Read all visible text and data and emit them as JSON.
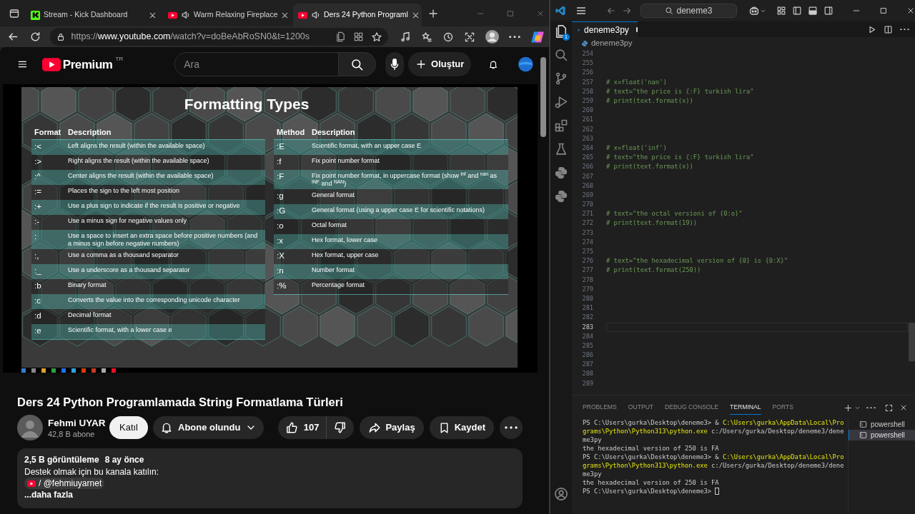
{
  "browser": {
    "tabs": [
      {
        "title": "Stream - Kick Dashboard",
        "kind": "kick",
        "audio": false,
        "selected": false
      },
      {
        "title": "Warm Relaxing Fireplace",
        "kind": "youtube",
        "audio": true,
        "selected": false
      },
      {
        "title": "Ders 24 Python Programl",
        "kind": "youtube",
        "audio": true,
        "selected": true
      }
    ],
    "url": {
      "scheme": "https://",
      "host": "www.youtube.com",
      "path": "/watch?v=doBeAbRoSN0&t=1200s"
    }
  },
  "youtube": {
    "logo": "Premium",
    "region": "TR",
    "search_placeholder": "Ara",
    "create": "Oluştur",
    "slide": {
      "title": "Formatting Types",
      "tables": [
        {
          "columns": [
            "Format",
            "Description"
          ],
          "rows": [
            {
              "code": ":<",
              "description": "Left aligns the result (within the available space)"
            },
            {
              "code": ":>",
              "description": "Right aligns the result (within the available space)"
            },
            {
              "code": ":^",
              "description": "Center aligns the result (within the available space)"
            },
            {
              "code": ":=",
              "description": "Places the sign to the left most position"
            },
            {
              "code": ":+",
              "description": "Use a plus sign to indicate if the result is positive or negative"
            },
            {
              "code": ":-",
              "description": "Use a minus sign for negative values only"
            },
            {
              "code": ":",
              "description": "Use a space to insert an extra space before positive numbers (and a minus sign before negative numbers)"
            },
            {
              "code": ":,",
              "description": "Use a comma as a thousand separator"
            },
            {
              "code": ":_",
              "description": "Use a underscore as a thousand separator"
            },
            {
              "code": ":b",
              "description": "Binary format"
            },
            {
              "code": ":c",
              "description": "Converts the value into the corresponding unicode character"
            },
            {
              "code": ":d",
              "description": "Decimal format"
            },
            {
              "code": ":e",
              "description": "Scientific format, with a lower case e"
            }
          ]
        },
        {
          "columns": [
            "Method",
            "Description"
          ],
          "rows": [
            {
              "code": ":E",
              "description": "Scientific format, with an upper case E"
            },
            {
              "code": ":f",
              "description": "Fix point number format"
            },
            {
              "code": ":F",
              "description": "Fix point number format, in uppercase format (show $^{inf}$ and $^{nan}$ as $^{INF}$ and $^{NAN}$)"
            },
            {
              "code": ":g",
              "description": "General format"
            },
            {
              "code": ":G",
              "description": "General format (using a upper case E for scientific notations)"
            },
            {
              "code": ":o",
              "description": "Octal format"
            },
            {
              "code": ":x",
              "description": "Hex format, lower case"
            },
            {
              "code": ":X",
              "description": "Hex format, upper case"
            },
            {
              "code": ":n",
              "description": "Number format"
            },
            {
              "code": ":%",
              "description": "Percentage format"
            }
          ]
        }
      ]
    },
    "video_title": "Ders 24 Python Programlamada String Formatlama Türleri",
    "channel": {
      "name": "Fehmi UYAR",
      "subscribers": "42,8 B abone"
    },
    "actions": {
      "join": "Katıl",
      "subscribe": "Abone olundu",
      "likes": "107",
      "share": "Paylaş",
      "save": "Kaydet"
    },
    "description": {
      "views": "2,5 B görüntüleme",
      "age": "8 ay önce",
      "text": "Destek olmak için bu kanala katılın:",
      "link": "/ @fehmiuyarnet",
      "more": "...daha fazla"
    }
  },
  "vscode": {
    "search": "deneme3",
    "explorer_badge": "1",
    "editor_tab": {
      "name": "deneme3py",
      "modified": true
    },
    "breadcrumb": "deneme3py",
    "lines": [
      {
        "number": "254",
        "current": false
      },
      {
        "number": "255",
        "current": false
      },
      {
        "number": "256",
        "current": false
      },
      {
        "number": "257",
        "text": "# x=float('nan')",
        "current": false
      },
      {
        "number": "258",
        "text": "# text=\"the price is {:F} turkish lira\"",
        "current": false
      },
      {
        "number": "259",
        "text": "# print(text.format(x))",
        "current": false
      },
      {
        "number": "260",
        "current": false
      },
      {
        "number": "261",
        "current": false
      },
      {
        "number": "262",
        "current": false
      },
      {
        "number": "263",
        "current": false
      },
      {
        "number": "264",
        "text": "# x=float('inf')",
        "current": false
      },
      {
        "number": "265",
        "text": "# text=\"the price is {:F} turkish lira\"",
        "current": false
      },
      {
        "number": "266",
        "text": "# print(text.format(x))",
        "current": false
      },
      {
        "number": "267",
        "current": false
      },
      {
        "number": "268",
        "current": false
      },
      {
        "number": "269",
        "current": false
      },
      {
        "number": "270",
        "current": false
      },
      {
        "number": "271",
        "text": "# text=\"the octal versioni of {0:o}\"",
        "current": false
      },
      {
        "number": "272",
        "text": "# print(text.format(19))",
        "current": false
      },
      {
        "number": "273",
        "current": false
      },
      {
        "number": "274",
        "current": false
      },
      {
        "number": "275",
        "current": false
      },
      {
        "number": "276",
        "text": "# text=\"the hexadecimal version of {0} is {0:X}\"",
        "current": false
      },
      {
        "number": "277",
        "text": "# print(text.format(250))",
        "current": false
      },
      {
        "number": "278",
        "current": false
      },
      {
        "number": "279",
        "current": false
      },
      {
        "number": "280",
        "current": false
      },
      {
        "number": "281",
        "current": false
      },
      {
        "number": "282",
        "current": false
      },
      {
        "number": "283",
        "current": true
      },
      {
        "number": "284",
        "current": false
      },
      {
        "number": "285",
        "current": false
      },
      {
        "number": "286",
        "current": false
      },
      {
        "number": "287",
        "current": false
      },
      {
        "number": "288",
        "current": false
      },
      {
        "number": "289",
        "current": false
      }
    ],
    "panel": {
      "tabs": [
        {
          "label": "PROBLEMS",
          "selected": false
        },
        {
          "label": "OUTPUT",
          "selected": false
        },
        {
          "label": "DEBUG CONSOLE",
          "selected": false
        },
        {
          "label": "TERMINAL",
          "selected": true
        },
        {
          "label": "PORTS",
          "selected": false
        }
      ],
      "terminal_lines": [
        [
          {
            "kind": "plain",
            "text": "PS C:\\Users\\gurka\\Desktop\\deneme3> & "
          },
          {
            "kind": "path",
            "text": "C:\\Users\\gurka\\AppData\\Local\\Pro"
          }
        ],
        [
          {
            "kind": "path",
            "text": "grams\\Python\\Python313\\python.exe"
          },
          {
            "kind": "plain",
            "text": " c:/Users/gurka/Desktop/deneme3/dene"
          }
        ],
        [
          {
            "kind": "plain",
            "text": "me3py"
          }
        ],
        [
          {
            "kind": "plain",
            "text": "the hexadecimal version of 250 is FA"
          }
        ],
        [
          {
            "kind": "plain",
            "text": "PS C:\\Users\\gurka\\Desktop\\deneme3> & "
          },
          {
            "kind": "path",
            "text": "C:\\Users\\gurka\\AppData\\Local\\Pro"
          }
        ],
        [
          {
            "kind": "path",
            "text": "grams\\Python\\Python313\\python.exe"
          },
          {
            "kind": "plain",
            "text": " c:/Users/gurka/Desktop/deneme3/dene"
          }
        ],
        [
          {
            "kind": "plain",
            "text": "me3py"
          }
        ],
        [
          {
            "kind": "plain",
            "text": "the hexadecimal version of 250 is FA"
          }
        ],
        [
          {
            "kind": "plain",
            "text": "PS C:\\Users\\gurka\\Desktop\\deneme3> "
          },
          {
            "kind": "cursor"
          }
        ]
      ],
      "terminals": [
        {
          "label": "powershell",
          "selected": false
        },
        {
          "label": "powershell",
          "selected": true
        }
      ]
    }
  }
}
